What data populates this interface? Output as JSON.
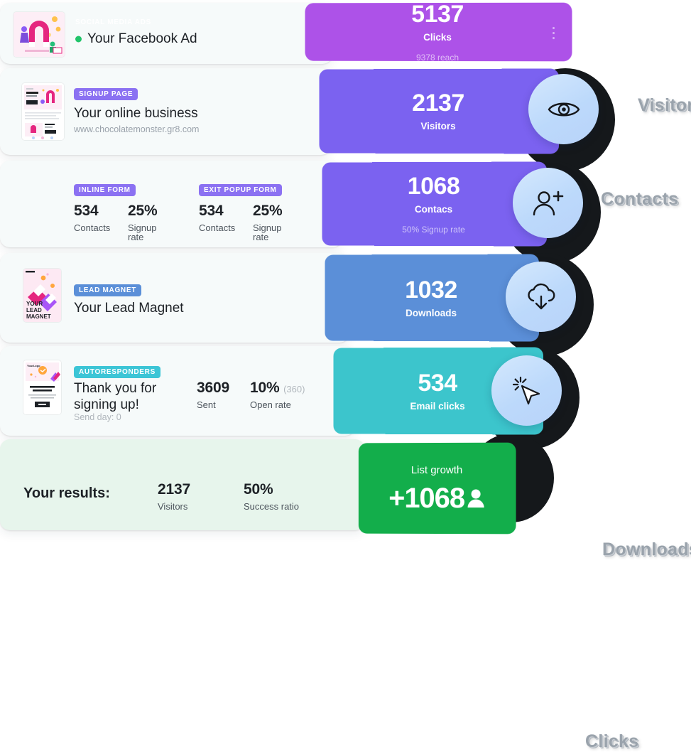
{
  "funnel": {
    "rows": [
      {
        "id": "social-media-ads",
        "badge": "SOCIAL MEDIA ADS",
        "badge_style": "ghost",
        "title": "Your Facebook Ad",
        "has_status_dot": true,
        "status_dot_color": "#21c46a",
        "url": "",
        "note": "",
        "stats": [],
        "panel": {
          "value": "5137",
          "caption": "Clicks",
          "note": "9378 reach",
          "color": "#ad52e8",
          "menu_icon": "kebab-menu-icon"
        },
        "bubble_icon": "",
        "outside_label": ""
      },
      {
        "id": "signup-page",
        "badge": "SIGNUP PAGE",
        "badge_style": "purple",
        "title": "Your online business",
        "has_status_dot": false,
        "url": "www.chocolatemonster.gr8.com",
        "note": "",
        "stats": [],
        "panel": {
          "value": "2137",
          "caption": "Visitors",
          "note": "",
          "color": "#7b62f0"
        },
        "bubble_icon": "eye-icon",
        "outside_label": "Visitors"
      },
      {
        "id": "forms",
        "badge": "",
        "badge_style": "",
        "title": "",
        "has_status_dot": false,
        "url": "",
        "note": "",
        "form_groups": [
          {
            "badge": "INLINE FORM",
            "badge_style": "purple",
            "stats": [
              {
                "value": "534",
                "label": "Contacts"
              },
              {
                "value": "25%",
                "label": "Signup rate"
              }
            ]
          },
          {
            "badge": "EXIT POPUP FORM",
            "badge_style": "purple",
            "stats": [
              {
                "value": "534",
                "label": "Contacts"
              },
              {
                "value": "25%",
                "label": "Signup rate"
              }
            ]
          }
        ],
        "panel": {
          "value": "1068",
          "caption": "Contacs",
          "note": "50% Signup rate",
          "color": "#7b62f0"
        },
        "bubble_icon": "add-person-icon",
        "outside_label": "Contacts"
      },
      {
        "id": "lead-magnet",
        "badge": "LEAD MAGNET",
        "badge_style": "blue",
        "title": "Your Lead Magnet",
        "has_status_dot": false,
        "url": "",
        "note": "",
        "stats": [],
        "panel": {
          "value": "1032",
          "caption": "Downloads",
          "note": "",
          "color": "#5b8fd8"
        },
        "bubble_icon": "cloud-download-icon",
        "outside_label": "Downloads"
      },
      {
        "id": "autoresponders",
        "badge": "AUTORESPONDERS",
        "badge_style": "cyan",
        "title": "Thank you for signing up!",
        "has_status_dot": false,
        "url": "",
        "note": "Send day: 0",
        "stats": [
          {
            "value": "3609",
            "label": "Sent",
            "paren": ""
          },
          {
            "value": "10%",
            "label": "Open rate",
            "paren": "(360)"
          }
        ],
        "panel": {
          "value": "534",
          "caption": "Email clicks",
          "note": "",
          "color": "#3cc5cc"
        },
        "bubble_icon": "click-cursor-icon",
        "outside_label": "Clicks"
      }
    ],
    "results": {
      "label": "Your results:",
      "stats": [
        {
          "value": "2137",
          "label": "Visitors"
        },
        {
          "value": "50%",
          "label": "Success ratio"
        }
      ],
      "panel": {
        "caption": "List growth",
        "value": "+1068",
        "person_glyph": "\u0003",
        "color": "#13ae4b"
      }
    }
  }
}
